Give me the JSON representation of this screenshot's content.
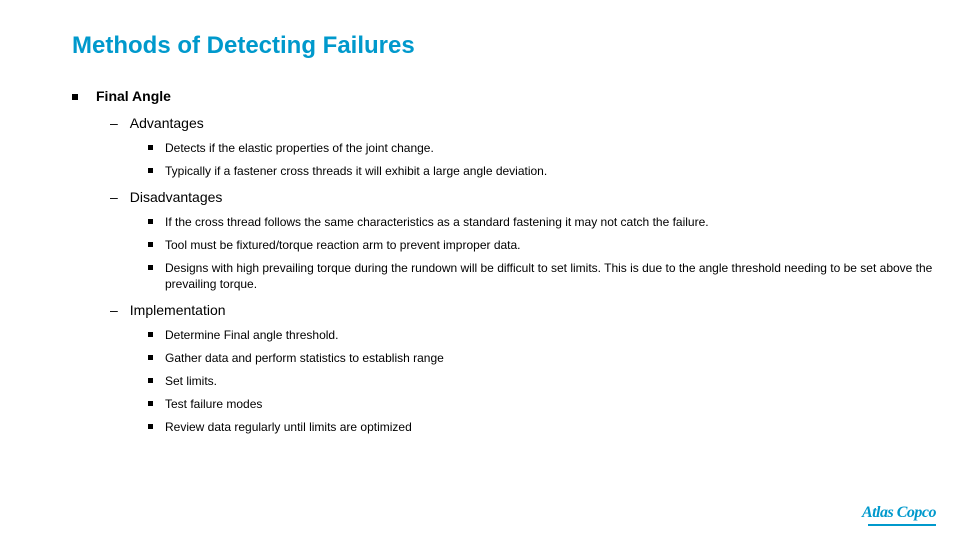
{
  "title": "Methods of Detecting Failures",
  "topic": "Final Angle",
  "sections": {
    "advantages": {
      "label": "Advantages",
      "items": [
        "Detects if the elastic properties of the joint change.",
        "Typically if a fastener cross threads it will exhibit a large angle deviation."
      ]
    },
    "disadvantages": {
      "label": "Disadvantages",
      "items": [
        "If the cross thread follows the same characteristics as a standard fastening it may not catch the failure.",
        "Tool must be fixtured/torque reaction arm to prevent improper data.",
        "Designs with high prevailing torque during the rundown will be difficult to set limits.  This is due to the angle threshold needing to be set above the prevailing torque."
      ]
    },
    "implementation": {
      "label": "Implementation",
      "items": [
        "Determine Final angle threshold.",
        "Gather data and perform statistics to establish range",
        "Set limits.",
        "Test failure modes",
        "Review data regularly until limits are optimized"
      ]
    }
  },
  "logo": "Atlas Copco",
  "colors": {
    "accent": "#0099cc"
  }
}
